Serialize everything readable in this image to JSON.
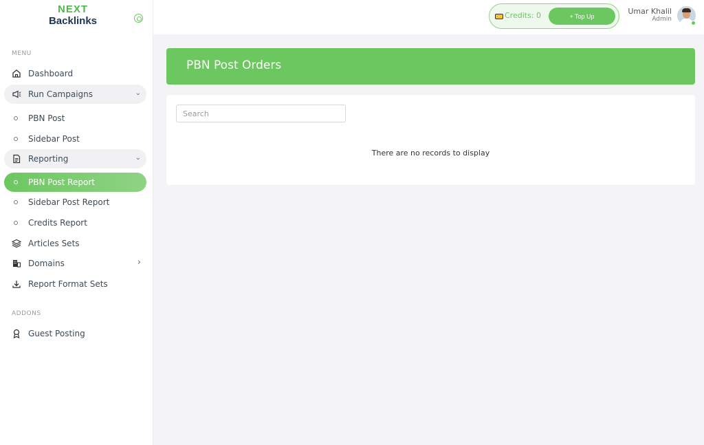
{
  "brand": {
    "logo_top": "NEXT",
    "logo_bottom": "Backlinks"
  },
  "sidebar": {
    "menu_label": "MENU",
    "items": [
      {
        "label": "Dashboard",
        "icon": "home-icon"
      },
      {
        "label": "Run Campaigns",
        "icon": "megaphone-icon"
      },
      {
        "label": "PBN Post"
      },
      {
        "label": "Sidebar Post"
      },
      {
        "label": "Reporting",
        "icon": "document-icon"
      },
      {
        "label": "PBN Post Report"
      },
      {
        "label": "Sidebar Post Report"
      },
      {
        "label": "Credits Report"
      },
      {
        "label": "Articles Sets",
        "icon": "layers-icon"
      },
      {
        "label": "Domains",
        "icon": "building-icon"
      },
      {
        "label": "Report Format Sets",
        "icon": "download-icon"
      }
    ],
    "addons_label": "ADDONS",
    "addons": [
      {
        "label": "Guest Posting",
        "icon": "award-icon"
      }
    ]
  },
  "topbar": {
    "credits_text": "Credits: 0",
    "topup_label": "+ Top Up",
    "user_name": "Umar Khalil",
    "user_role": "Admin"
  },
  "main": {
    "title": "PBN Post Orders",
    "search_placeholder": "Search",
    "empty_message": "There are no records to display"
  },
  "colors": {
    "accent": "#6cc760",
    "sidebar_bg": "#ffffff",
    "page_bg": "#f4f4f6"
  }
}
